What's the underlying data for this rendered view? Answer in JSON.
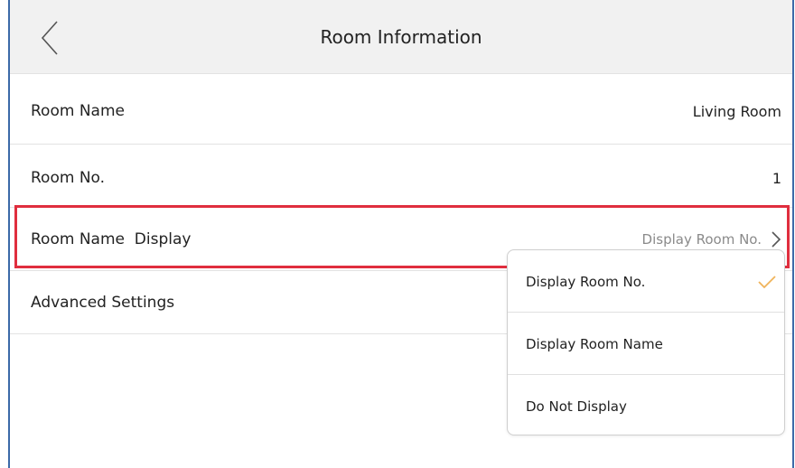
{
  "header": {
    "title": "Room Information",
    "back_icon": "chevron-left-icon"
  },
  "rows": [
    {
      "label": "Room Name",
      "value": "Living Room"
    },
    {
      "label": "Room No.",
      "value": "1"
    },
    {
      "label": "Room Name  Display",
      "value": "Display Room No.",
      "icon": "chevron-right-icon"
    },
    {
      "label": "Advanced Settings"
    }
  ],
  "dropdown": {
    "options": [
      {
        "label": "Display Room No.",
        "selected": true
      },
      {
        "label": "Display Room Name",
        "selected": false
      },
      {
        "label": "Do Not Display",
        "selected": false
      }
    ],
    "check_icon": "checkmark-icon",
    "check_color": "#f0b35a"
  },
  "colors": {
    "highlight_border": "#e02e3e",
    "frame_border": "#3c6aa8",
    "header_bg": "#f1f1f1"
  }
}
